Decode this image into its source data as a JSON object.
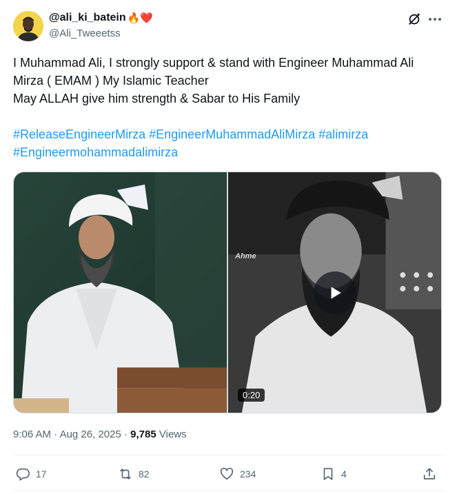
{
  "author": {
    "display_name": "@ali_ki_batein",
    "display_name_emoji": "🔥❤️",
    "handle": "@Ali_Tweeetss"
  },
  "tweet": {
    "lines": [
      "I  Muhammad Ali, I strongly support & stand with Engineer Muhammad Ali Mirza ( EMAM ) My Islamic Teacher",
      "May ALLAH give him strength & Sabar to His Family"
    ],
    "hashtags": [
      "#ReleaseEngineerMirza",
      "#EngineerMuhammadAliMirza",
      "#alimirza",
      "#Engineermohammadalimirza"
    ]
  },
  "media": {
    "video_duration": "0:20",
    "video_watermark": "Ahme"
  },
  "meta": {
    "time": "9:06 AM",
    "separator": "·",
    "date": "Aug 26, 2025",
    "views_count": "9,785",
    "views_label": "Views"
  },
  "actions": {
    "replies": "17",
    "reposts": "82",
    "likes": "234",
    "bookmarks": "4"
  },
  "icons": {
    "grok": "grok-icon",
    "more": "more-icon",
    "reply": "reply-icon",
    "repost": "repost-icon",
    "like": "heart-icon",
    "bookmark": "bookmark-icon",
    "share": "share-icon",
    "play": "play-icon"
  },
  "colors": {
    "link": "#1d9bf0",
    "secondary_text": "#536471",
    "primary_text": "#0f1419"
  }
}
